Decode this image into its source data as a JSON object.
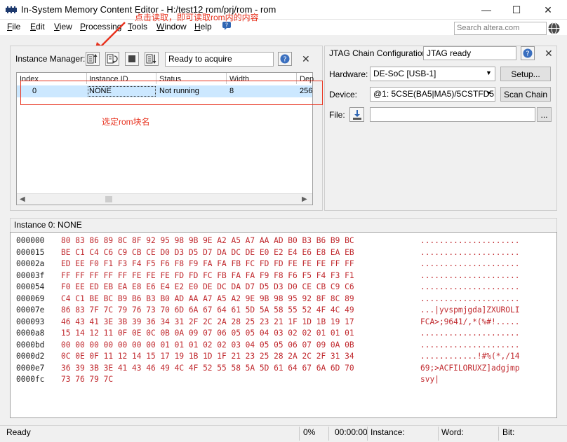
{
  "window": {
    "title": "In-System Memory Content Editor - H:/test12 rom/prj/rom - rom",
    "min": "—",
    "max": "☐",
    "close": "✕"
  },
  "menu": {
    "items": [
      {
        "label": "File",
        "u": "F",
        "rest": "ile"
      },
      {
        "label": "Edit",
        "u": "E",
        "rest": "dit"
      },
      {
        "label": "View",
        "u": "V",
        "rest": "iew"
      },
      {
        "label": "Processing",
        "u": "P",
        "rest": "rocessing"
      },
      {
        "label": "Tools",
        "u": "T",
        "rest": "ools"
      },
      {
        "label": "Window",
        "u": "W",
        "rest": "indow"
      },
      {
        "label": "Help",
        "u": "H",
        "rest": "elp"
      }
    ],
    "search_placeholder": "Search altera.com"
  },
  "annotations": {
    "top": "点击读取，即可读取rom内的内容",
    "select": "选定rom块名"
  },
  "instance_manager": {
    "label": "Instance Manager:",
    "status": "Ready to acquire",
    "columns": [
      "Index",
      "Instance ID",
      "Status",
      "Width",
      "Dep"
    ],
    "rows": [
      {
        "index": "0",
        "id": "NONE",
        "status": "Not running",
        "width": "8",
        "depth": "256"
      }
    ]
  },
  "jtag": {
    "label": "JTAG Chain Configuration:",
    "status": "JTAG ready",
    "hardware_label": "Hardware:",
    "hardware_value": "DE-SoC [USB-1]",
    "setup_button": "Setup...",
    "device_label": "Device:",
    "device_value": "@1: 5CSE(BA5|MA5)/5CSTFD5D",
    "scan_button": "Scan Chain",
    "file_label": "File:",
    "file_value": "",
    "browse_button": "..."
  },
  "memory": {
    "title": "Instance 0: NONE",
    "rows": [
      {
        "addr": "000000",
        "hex": "80 83 86 89 8C 8F 92 95 98 9B 9E A2 A5 A7 AA AD B0 B3 B6 B9 BC",
        "ascii": "....................."
      },
      {
        "addr": "000015",
        "hex": "BE C1 C4 C6 C9 CB CE D0 D3 D5 D7 DA DC DE E0 E2 E4 E6 E8 EA EB",
        "ascii": "....................."
      },
      {
        "addr": "00002a",
        "hex": "ED EE F0 F1 F3 F4 F5 F6 F8 F9 FA FA FB FC FD FD FE FE FE FF FF",
        "ascii": "....................."
      },
      {
        "addr": "00003f",
        "hex": "FF FF FF FF FF FE FE FE FD FD FC FB FA FA F9 F8 F6 F5 F4 F3 F1",
        "ascii": "....................."
      },
      {
        "addr": "000054",
        "hex": "F0 EE ED EB EA E8 E6 E4 E2 E0 DE DC DA D7 D5 D3 D0 CE CB C9 C6",
        "ascii": "....................."
      },
      {
        "addr": "000069",
        "hex": "C4 C1 BE BC B9 B6 B3 B0 AD AA A7 A5 A2 9E 9B 98 95 92 8F 8C 89",
        "ascii": "....................."
      },
      {
        "addr": "00007e",
        "hex": "86 83 7F 7C 79 76 73 70 6D 6A 67 64 61 5D 5A 58 55 52 4F 4C 49",
        "ascii": "...|yvspmjgda]ZXUROLI"
      },
      {
        "addr": "000093",
        "hex": "46 43 41 3E 3B 39 36 34 31 2F 2C 2A 28 25 23 21 1F 1D 1B 19 17",
        "ascii": "FCA>;9641/,*(%#!....."
      },
      {
        "addr": "0000a8",
        "hex": "15 14 12 11 0F 0E 0C 0B 0A 09 07 06 05 05 04 03 02 02 01 01 01",
        "ascii": "....................."
      },
      {
        "addr": "0000bd",
        "hex": "00 00 00 00 00 00 00 01 01 01 02 02 03 04 05 05 06 07 09 0A 0B",
        "ascii": "....................."
      },
      {
        "addr": "0000d2",
        "hex": "0C 0E 0F 11 12 14 15 17 19 1B 1D 1F 21 23 25 28 2A 2C 2F 31 34",
        "ascii": "............!#%(*,/14"
      },
      {
        "addr": "0000e7",
        "hex": "36 39 3B 3E 41 43 46 49 4C 4F 52 55 58 5A 5D 61 64 67 6A 6D 70",
        "ascii": "69;>ACFILORUXZ]adgjmp"
      },
      {
        "addr": "0000fc",
        "hex": "73 76 79 7C",
        "ascii": "svy|"
      }
    ]
  },
  "statusbar": {
    "ready": "Ready",
    "progress": "0%",
    "time": "00:00:00",
    "instance": "Instance:",
    "word": "Word:",
    "bit": "Bit:"
  },
  "colors": {
    "annotation": "#e8321e",
    "hex_text": "#c0282d",
    "selection": "#cce8ff"
  }
}
